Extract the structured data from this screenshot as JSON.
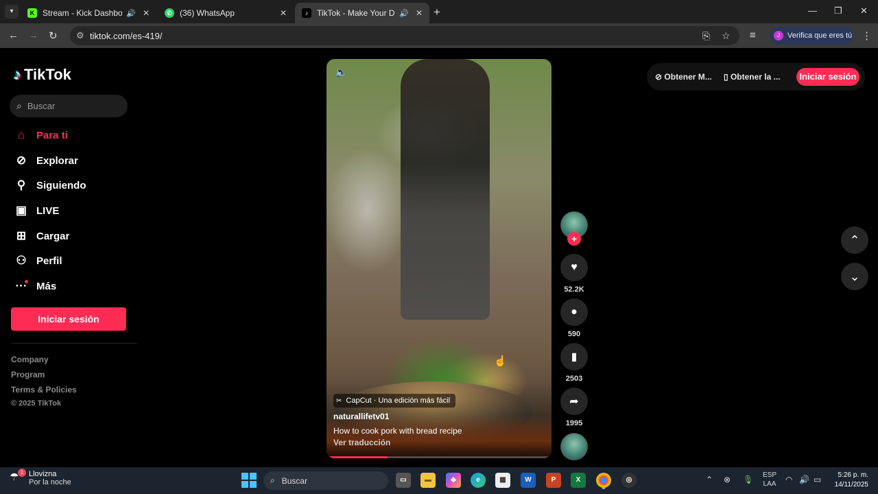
{
  "browser": {
    "tabs": [
      {
        "label": "Stream - Kick Dashboard",
        "icon": "kick-icon",
        "audio": true,
        "active": false
      },
      {
        "label": "(36) WhatsApp",
        "icon": "whatsapp-icon",
        "audio": false,
        "active": false
      },
      {
        "label": "TikTok - Make Your Day",
        "icon": "tiktok-icon",
        "audio": true,
        "active": true
      }
    ],
    "url": "tiktok.com/es-419/",
    "verify_label": "Verifica que eres tú",
    "profile_initial": "J"
  },
  "tiktok": {
    "logo_text": "TikTok",
    "search_placeholder": "Buscar",
    "nav": [
      {
        "label": "Para ti",
        "icon": "home-icon",
        "active": true
      },
      {
        "label": "Explorar",
        "icon": "compass-icon",
        "active": false
      },
      {
        "label": "Siguiendo",
        "icon": "following-icon",
        "active": false
      },
      {
        "label": "LIVE",
        "icon": "live-icon",
        "active": false
      },
      {
        "label": "Cargar",
        "icon": "upload-icon",
        "active": false
      },
      {
        "label": "Perfil",
        "icon": "profile-icon",
        "active": false
      },
      {
        "label": "Más",
        "icon": "more-icon",
        "active": false
      }
    ],
    "login_label": "Iniciar sesión",
    "footer_links": [
      "Company",
      "Program",
      "Terms & Policies"
    ],
    "copyright": "© 2025 TikTok",
    "top_right": {
      "get_app_1": "Obtener M...",
      "get_app_2": "Obtener la ...",
      "login": "Iniciar sesión"
    },
    "video": {
      "capcut_label": "CapCut · Una edición más fácil",
      "author": "naturallifetv01",
      "description": "How to cook pork with bread recipe",
      "translate": "Ver traducción",
      "progress": 0.27
    },
    "actions": {
      "likes": "52.2K",
      "comments": "590",
      "saves": "2503",
      "shares": "1995"
    }
  },
  "taskbar": {
    "weather_title": "Llovizna",
    "weather_sub": "Por la noche",
    "weather_badge": "1",
    "search_label": "Buscar",
    "lang_1": "ESP",
    "lang_2": "LAA",
    "time": "5:26 p. m.",
    "date": "14/11/2025"
  },
  "colors": {
    "accent": "#fe2c55",
    "page_bg": "#000000",
    "browser_bg": "#1f1f1f"
  }
}
